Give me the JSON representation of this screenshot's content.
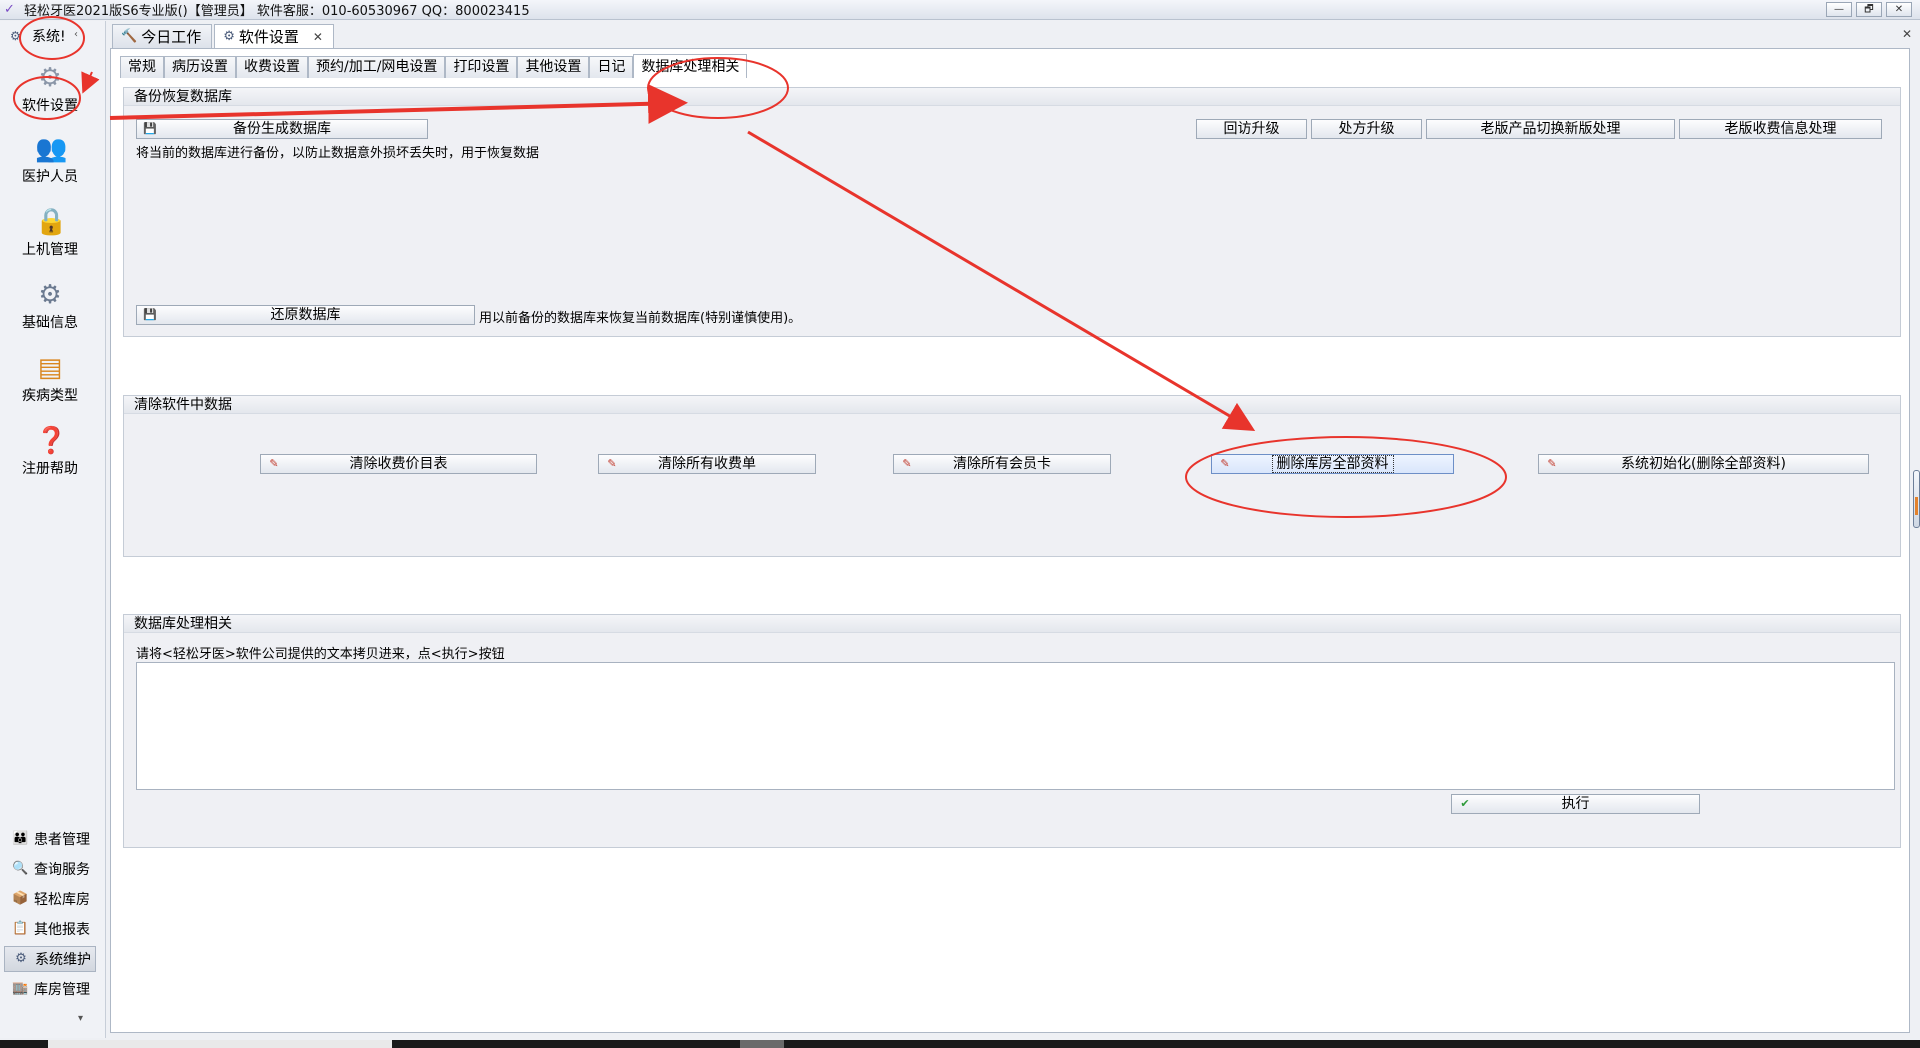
{
  "window": {
    "title": "轻松牙医2021版S6专业版()【管理员】    软件客服：010-60530967 QQ：800023415",
    "buttons": [
      "—",
      "🗗",
      "✕"
    ]
  },
  "sidebar": {
    "header": "系统!",
    "collapse_glyph": "‹",
    "big_items": [
      {
        "label": "软件设置",
        "icon": "gear-icon"
      },
      {
        "label": "医护人员",
        "icon": "staff-icon"
      },
      {
        "label": "上机管理",
        "icon": "lock-icon"
      },
      {
        "label": "基础信息",
        "icon": "settings-doc-icon"
      },
      {
        "label": "疾病类型",
        "icon": "tree-icon"
      },
      {
        "label": "注册帮助",
        "icon": "help-book-icon"
      }
    ],
    "small_items": [
      {
        "label": "患者管理",
        "icon": "people-icon"
      },
      {
        "label": "查询服务",
        "icon": "search-icon"
      },
      {
        "label": "轻松库房",
        "icon": "box-icon"
      },
      {
        "label": "其他报表",
        "icon": "report-icon"
      },
      {
        "label": "系统维护",
        "icon": "gear-icon",
        "active": true
      },
      {
        "label": "库房管理",
        "icon": "warehouse-icon"
      }
    ],
    "more_glyph": "▾"
  },
  "doc_tabs": [
    {
      "label": "今日工作",
      "icon": "work-icon"
    },
    {
      "label": "软件设置",
      "icon": "gear-icon",
      "active": true,
      "close": "✕"
    }
  ],
  "main_close": "✕",
  "settings_tabs": [
    "常规",
    "病历设置",
    "收费设置",
    "预约/加工/网电设置",
    "打印设置",
    "其他设置",
    "日记",
    "数据库处理相关"
  ],
  "active_settings_tab": 7,
  "backup_group": {
    "title": "备份恢复数据库",
    "backup_button": "备份生成数据库",
    "backup_note": "将当前的数据库进行备份，以防止数据意外损坏丢失时，用于恢复数据",
    "restore_button": "还原数据库",
    "restore_note": "用以前备份的数据库来恢复当前数据库(特别谨慎使用)。",
    "upgrade_buttons": [
      "回访升级",
      "处方升级",
      "老版产品切换新版处理",
      "老版收费信息处理"
    ]
  },
  "clear_group": {
    "title": "清除软件中数据",
    "buttons": [
      "清除收费价目表",
      "清除所有收费单",
      "清除所有会员卡",
      "删除库房全部资料",
      "系统初始化(删除全部资料)"
    ]
  },
  "db_group": {
    "title": "数据库处理相关",
    "instruction": "请将<轻松牙医>软件公司提供的文本拷贝进来，点<执行>按钮",
    "textarea_value": "",
    "execute_button": "执行"
  },
  "colors": {
    "annotation_red": "#e8342c",
    "focus_blue": "#6d8fc7"
  }
}
